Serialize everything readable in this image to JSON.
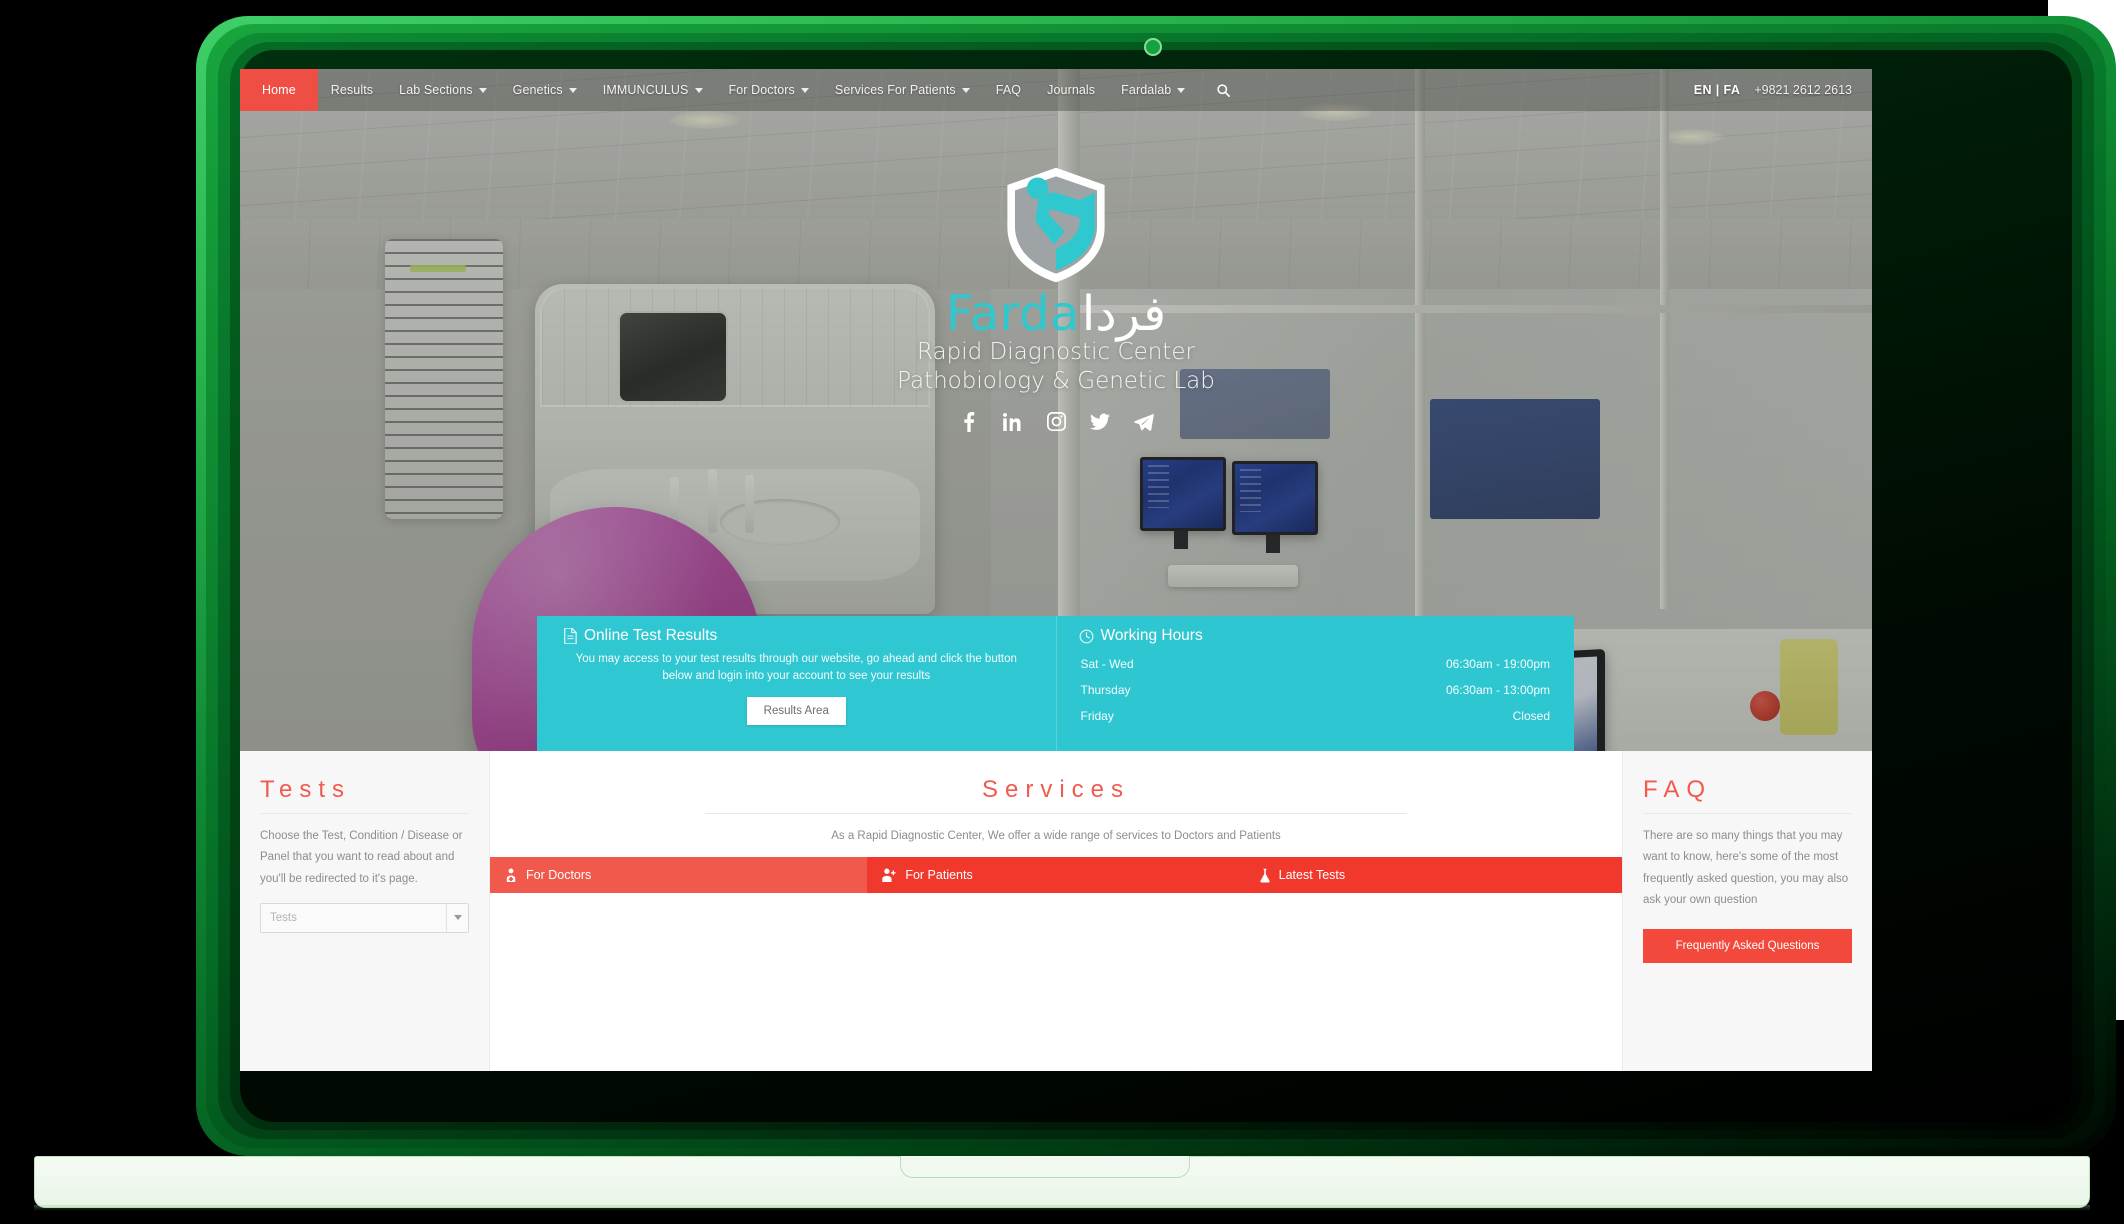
{
  "brand": {
    "name_en": "Farda",
    "name_fa": "فردا",
    "tagline_line1": "Rapid Diagnostic Center",
    "tagline_line2": "Pathobiology & Genetic Lab",
    "accent_teal": "#2ec6d0",
    "accent_red": "#f0392c",
    "frame_green": "#16a33e"
  },
  "navbar": {
    "items": [
      {
        "label": "Home",
        "has_caret": false,
        "active": true
      },
      {
        "label": "Results",
        "has_caret": false,
        "active": false
      },
      {
        "label": "Lab Sections",
        "has_caret": true,
        "active": false
      },
      {
        "label": "Genetics",
        "has_caret": true,
        "active": false
      },
      {
        "label": "IMMUNCULUS",
        "has_caret": true,
        "active": false
      },
      {
        "label": "For Doctors",
        "has_caret": true,
        "active": false
      },
      {
        "label": "Services For Patients",
        "has_caret": true,
        "active": false
      },
      {
        "label": "FAQ",
        "has_caret": false,
        "active": false
      },
      {
        "label": "Journals",
        "has_caret": false,
        "active": false
      },
      {
        "label": "Fardalab",
        "has_caret": true,
        "active": false
      }
    ],
    "search_icon": "search-icon",
    "language": "EN | FA",
    "phone": "+9821 2612 2613"
  },
  "socials": [
    {
      "name": "facebook-icon"
    },
    {
      "name": "linkedin-icon"
    },
    {
      "name": "instagram-icon"
    },
    {
      "name": "twitter-icon"
    },
    {
      "name": "telegram-icon"
    }
  ],
  "online_results": {
    "icon": "document-icon",
    "title": "Online Test Results",
    "body": "You may access to your test results through our website, go ahead and click the button below and login into your account to see your results",
    "button_label": "Results Area"
  },
  "working_hours": {
    "icon": "clock-icon",
    "title": "Working Hours",
    "rows": [
      {
        "days": "Sat - Wed",
        "time": "06:30am - 19:00pm"
      },
      {
        "days": "Thursday",
        "time": "06:30am - 13:00pm"
      },
      {
        "days": "Friday",
        "time": "Closed"
      }
    ]
  },
  "tests_panel": {
    "title": "Tests",
    "body": "Choose the Test, Condition / Disease or Panel that you want to read about and you'll be redirected to it's page.",
    "select_placeholder": "Tests"
  },
  "services_panel": {
    "title": "Services",
    "body": "As a Rapid Diagnostic Center, We offer a wide range of services to Doctors and Patients",
    "tabs": [
      {
        "label": "For Doctors",
        "icon": "doctor-icon",
        "active": true
      },
      {
        "label": "For Patients",
        "icon": "user-plus-icon",
        "active": false
      },
      {
        "label": "Latest Tests",
        "icon": "flask-icon",
        "active": false
      }
    ]
  },
  "faq_panel": {
    "title": "FAQ",
    "body": "There are so many things that you may want to know, here's some of the most frequently asked question, you may also ask your own question",
    "button_label": "Frequently Asked Questions"
  }
}
